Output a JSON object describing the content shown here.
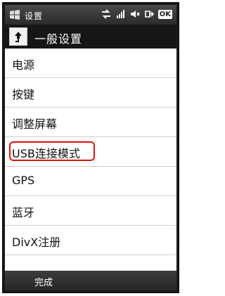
{
  "statusbar": {
    "start_icon": "windows-flag-icon",
    "title": "设置",
    "icons": [
      "network-arrows-icon",
      "signal-icon",
      "volume-mute-icon",
      "connection-icon",
      "ok-button"
    ],
    "ok_label": "OK"
  },
  "header": {
    "back_icon": "back-arrow-icon",
    "title": "一般设置"
  },
  "list": {
    "items": [
      {
        "label": "电源"
      },
      {
        "label": "按键"
      },
      {
        "label": "调整屏幕"
      },
      {
        "label": "USB连接模式"
      },
      {
        "label": "GPS"
      },
      {
        "label": "蓝牙"
      },
      {
        "label": "DivX注册"
      }
    ],
    "highlight_color": "#e01010"
  },
  "softkeys": {
    "left_label": "完成"
  }
}
